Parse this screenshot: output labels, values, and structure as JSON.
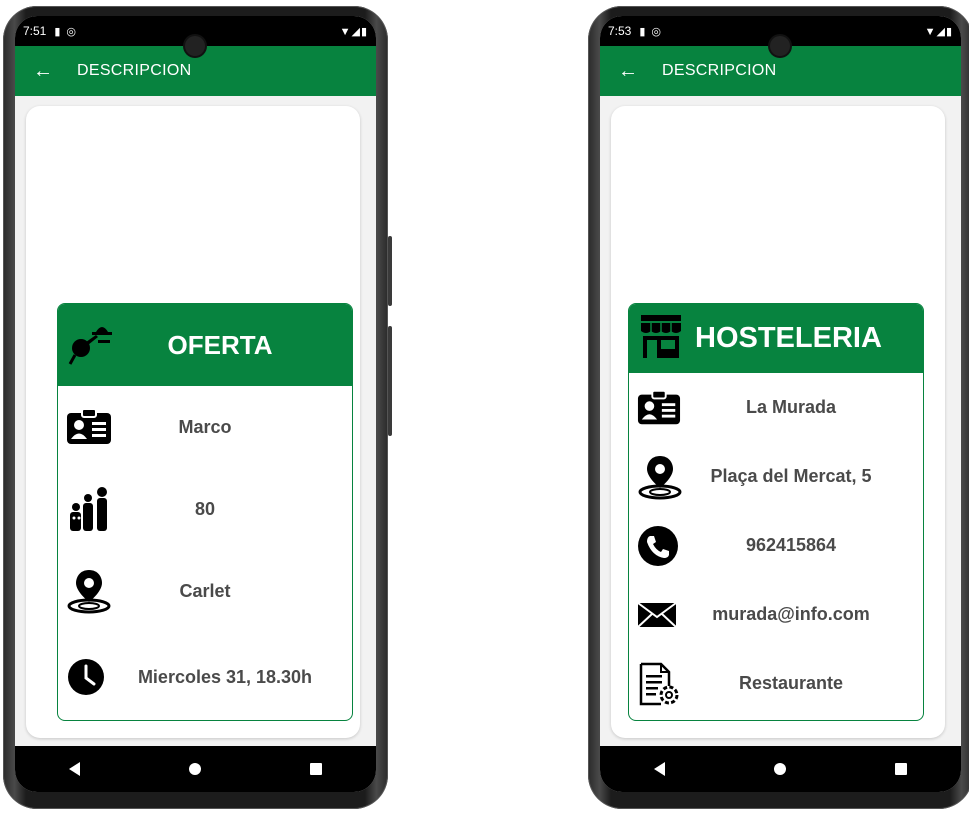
{
  "screens": [
    {
      "status_time": "7:51",
      "appbar_title": "DESCRIPCION",
      "header_title": "OFERTA",
      "rows": [
        {
          "icon": "contact-card-icon",
          "text": "Marco"
        },
        {
          "icon": "family-icon",
          "text": "80"
        },
        {
          "icon": "location-pin-icon",
          "text": "Carlet"
        },
        {
          "icon": "clock-icon",
          "text": "Miercoles 31, 18.30h"
        }
      ]
    },
    {
      "status_time": "7:53",
      "appbar_title": "DESCRIPCION",
      "header_title": "HOSTELERIA",
      "rows": [
        {
          "icon": "contact-card-icon",
          "text": "La Murada"
        },
        {
          "icon": "location-pin-icon",
          "text": "Plaça del Mercat, 5"
        },
        {
          "icon": "phone-icon",
          "text": "962415864"
        },
        {
          "icon": "envelope-icon",
          "text": "murada@info.com"
        },
        {
          "icon": "document-settings-icon",
          "text": "Restaurante"
        }
      ]
    }
  ],
  "colors": {
    "brand_green": "#07833f",
    "text_gray": "#4a4a4a",
    "screen_bg": "#f2f2f2"
  }
}
